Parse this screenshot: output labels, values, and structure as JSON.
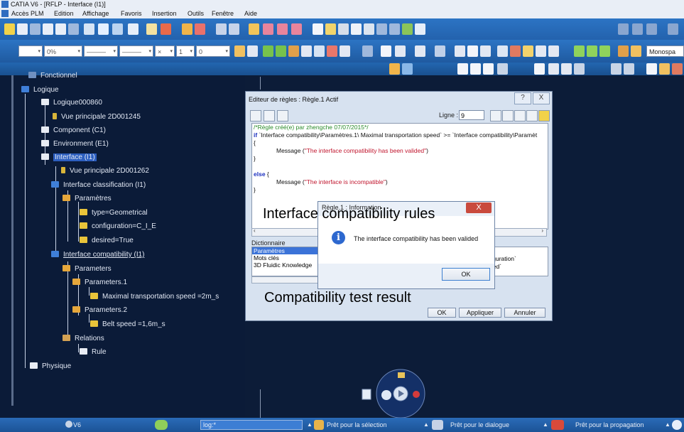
{
  "window": {
    "title": "CATIA V6 - [RFLP - Interface (I1)]",
    "menu": [
      "Accès PLM",
      "Edition",
      "Affichage",
      "Favoris",
      "Insertion",
      "Outils",
      "Fenêtre",
      "Aide"
    ]
  },
  "toolbar": {
    "percent_combo": "0%",
    "zero_combo": "0",
    "font_combo": "Monospa"
  },
  "tree": {
    "items": [
      {
        "label": "Fonctionnel"
      },
      {
        "label": "Logique"
      },
      {
        "label": "Logique000860"
      },
      {
        "label": "Vue principale 2D001245"
      },
      {
        "label": "Component (C1)"
      },
      {
        "label": "Environment (E1)"
      },
      {
        "label": "Interface (I1)"
      },
      {
        "label": "Vue principale 2D001262"
      },
      {
        "label": "Interface classification (I1)"
      },
      {
        "label": "Paramètres"
      },
      {
        "label": "type=Geometrical"
      },
      {
        "label": "configuration=C_I_E"
      },
      {
        "label": "desired=True"
      },
      {
        "label": "Interface compatibility (I1)"
      },
      {
        "label": "Parameters"
      },
      {
        "label": "Parameters.1"
      },
      {
        "label": "Maximal transportation speed =2m_s"
      },
      {
        "label": "Parameters.2"
      },
      {
        "label": "Belt speed =1,6m_s"
      },
      {
        "label": "Relations"
      },
      {
        "label": "Rule"
      },
      {
        "label": "Physique"
      }
    ]
  },
  "rule_editor": {
    "title": "Editeur de règles : Règle.1 Actif",
    "help_button": "?",
    "close_button": "X",
    "line_label": "Ligne :",
    "line_value": "9",
    "code": {
      "comment": "/*Règle créé(e) par zhengche 07/07/2015*/",
      "if_keyword": "if",
      "condition": " `Interface compatibility\\Paramètres.1\\ Maximal transportation speed` >= `Interface compatibility\\Paramèt",
      "open_brace": "{",
      "message_fn_1": "Message (",
      "message_1": "\"The interface compatibility has been valided\"",
      "close_paren_1": ")",
      "close_brace": "}",
      "else_keyword": "else",
      "else_brace": " {",
      "message_fn_2": "Message (",
      "message_2": "\"The interface is incompatible\"",
      "close_paren_2": ")",
      "close_brace_2": "}"
    },
    "dictionary_label": "Dictionnaire",
    "dictionary_items": [
      "Paramètres",
      "Mots clés",
      "3D Fluidic Knowledge"
    ],
    "right_list_items": [
      "e`",
      "figuration`",
      "ired`"
    ],
    "buttons": {
      "ok": "OK",
      "apply": "Appliquer",
      "cancel": "Annuler"
    }
  },
  "info_dialog": {
    "title": "Règle.1 : Information",
    "close": "X",
    "message": "The interface compatibility has been valided",
    "ok": "OK"
  },
  "annotations": {
    "rules": "Interface compatibility rules",
    "result": "Compatibility test result"
  },
  "status_bar": {
    "v6_label": "V6",
    "log_field": "log:*",
    "selection": "Prêt pour la sélection",
    "dialog": "Prêt pour le dialogue",
    "propagation": "Prêt pour la propagation"
  }
}
